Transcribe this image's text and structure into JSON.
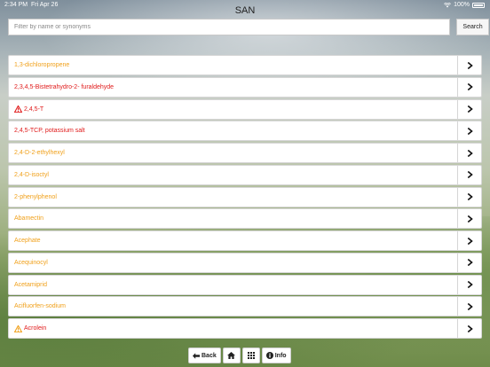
{
  "status_bar": {
    "time": "2:34 PM",
    "date": "Fri Apr 26",
    "battery": "100%"
  },
  "app": {
    "title": "SAN"
  },
  "search": {
    "placeholder": "Filter by name or synonyms",
    "value": "",
    "button_label": "Search"
  },
  "colors": {
    "orange": "#f0a01a",
    "red": "#e01a1a",
    "dark": "#222222"
  },
  "list": {
    "items": [
      {
        "label": "1,3-dichloropropene",
        "color": "orange",
        "warning": false
      },
      {
        "label": "2,3,4,5-Bistetrahydro-2- furaldehyde",
        "color": "red",
        "warning": false
      },
      {
        "label": "2,4,5-T",
        "color": "red",
        "warning": true,
        "warning_color": "red"
      },
      {
        "label": "2,4,5-TCP, potassium salt",
        "color": "red",
        "warning": false
      },
      {
        "label": "2,4-D-2-ethylhexyl",
        "color": "orange",
        "warning": false
      },
      {
        "label": "2,4-D-isoctyl",
        "color": "orange",
        "warning": false
      },
      {
        "label": "2-phenylphenol",
        "color": "orange",
        "warning": false
      },
      {
        "label": "Abamectin",
        "color": "orange",
        "warning": false
      },
      {
        "label": "Acephate",
        "color": "orange",
        "warning": false
      },
      {
        "label": "Acequinocyl",
        "color": "orange",
        "warning": false
      },
      {
        "label": "Acetamiprid",
        "color": "orange",
        "warning": false
      },
      {
        "label": "Acifluorfen-sodium",
        "color": "orange",
        "warning": false
      },
      {
        "label": "Acrolein",
        "color": "red",
        "warning": true,
        "warning_color": "orange"
      }
    ]
  },
  "toolbar": {
    "back_label": "Back",
    "info_label": "Info",
    "icons": {
      "back": "arrow-left-icon",
      "home": "home-icon",
      "grid": "grid-icon",
      "info": "info-circle-icon"
    }
  }
}
